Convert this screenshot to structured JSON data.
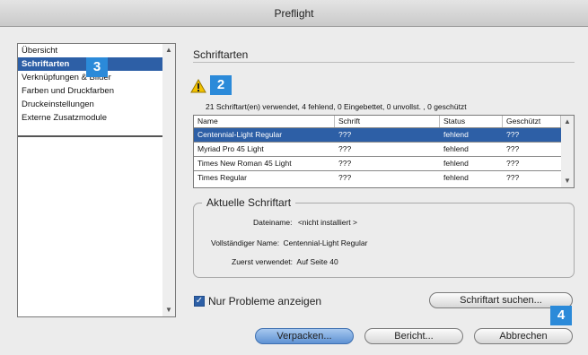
{
  "window": {
    "title": "Preflight"
  },
  "sidebar": {
    "items": [
      {
        "label": "Übersicht"
      },
      {
        "label": "Schriftarten"
      },
      {
        "label": "Verknüpfungen & Bilder"
      },
      {
        "label": "Farben und Druckfarben"
      },
      {
        "label": "Druckeinstellungen"
      },
      {
        "label": "Externe Zusatzmodule"
      }
    ],
    "selected_index": 1
  },
  "callouts": {
    "badge_sidebar": "3",
    "badge_warning": "2",
    "badge_search": "4"
  },
  "main": {
    "section_title": "Schriftarten",
    "summary": "21 Schriftart(en) verwendet, 4 fehlend, 0 Eingebettet, 0 unvollst. , 0 geschützt",
    "table": {
      "headers": [
        "Name",
        "Schrift",
        "Status",
        "Geschützt"
      ],
      "rows": [
        {
          "name": "Centennial-Light Regular",
          "schrift": "???",
          "status": "fehlend",
          "geschuetzt": "???"
        },
        {
          "name": "Myriad Pro 45 Light",
          "schrift": "???",
          "status": "fehlend",
          "geschuetzt": "???"
        },
        {
          "name": "Times New Roman 45 Light",
          "schrift": "???",
          "status": "fehlend",
          "geschuetzt": "???"
        },
        {
          "name": "Times Regular",
          "schrift": "???",
          "status": "fehlend",
          "geschuetzt": "???"
        }
      ],
      "selected_row": 0
    },
    "current_font": {
      "title": "Aktuelle Schriftart",
      "filename_label": "Dateiname:",
      "filename_value": "<nicht installiert >",
      "fullname_label": "Vollständiger Name:",
      "fullname_value": "Centennial-Light Regular",
      "firstused_label": "Zuerst verwendet:",
      "firstused_value": "Auf Seite 40"
    },
    "only_problems": {
      "label": "Nur Probleme anzeigen",
      "checked": true
    },
    "find_font_button": "Schriftart suchen..."
  },
  "footer": {
    "package_button": "Verpacken...",
    "report_button": "Bericht...",
    "cancel_button": "Abbrechen"
  },
  "colors": {
    "selection": "#2d5fa6",
    "badge": "#2b8ad9",
    "warning": "#f2c200"
  }
}
